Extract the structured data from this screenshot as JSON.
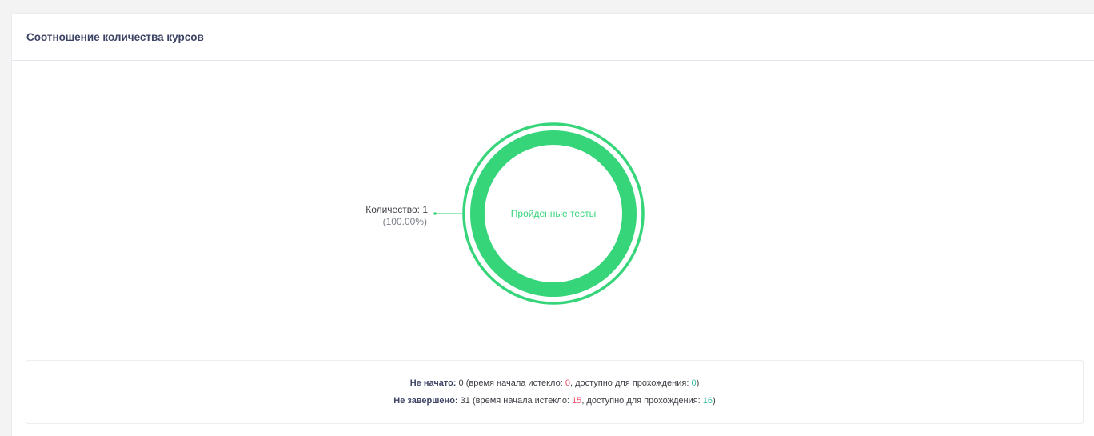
{
  "card": {
    "title": "Соотношение количества курсов"
  },
  "chart_data": {
    "type": "pie",
    "categories": [
      "Пройденные тесты"
    ],
    "values": [
      1
    ],
    "center_label": "Пройденные тесты",
    "slice_labels": [
      {
        "line1": "Количество: 1",
        "line2": "(100.00%)"
      }
    ],
    "colors": [
      "#36d57a"
    ]
  },
  "summary": {
    "not_started": {
      "label": "Не начато:",
      "count": "0",
      "expired_text": "(время начала истекло:",
      "expired_value": "0",
      "available_text": ", доступно для прохождения:",
      "available_value": "0",
      "close": ")"
    },
    "not_finished": {
      "label": "Не завершено:",
      "count": "31",
      "expired_text": "(время начала истекло:",
      "expired_value": "15",
      "available_text": ", доступно для прохождения:",
      "available_value": "16",
      "close": ")"
    }
  },
  "colors": {
    "accent_green": "#36d57a",
    "red": "#f4516c",
    "teal": "#34bfa3"
  }
}
